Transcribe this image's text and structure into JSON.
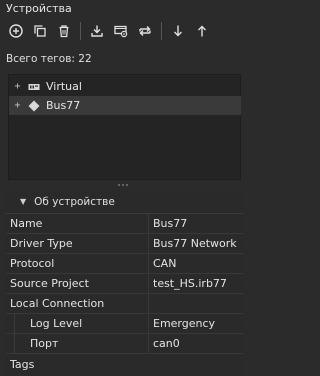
{
  "panel": {
    "title": "Устройства"
  },
  "toolbar": {
    "buttons": [
      {
        "icon": "add-circle-icon"
      },
      {
        "icon": "copy-icon"
      },
      {
        "icon": "trash-icon"
      },
      {
        "icon": "import-icon"
      },
      {
        "icon": "device-settings-icon"
      },
      {
        "icon": "swap-icon"
      },
      {
        "icon": "arrow-down-icon"
      },
      {
        "icon": "arrow-up-icon"
      }
    ]
  },
  "tag_count": "Всего тегов: 22",
  "tree": {
    "items": [
      {
        "label": "Virtual",
        "expander": "+",
        "icon": "virtual-device-icon",
        "selected": false
      },
      {
        "label": "Bus77",
        "expander": "+",
        "icon": "diamond-icon",
        "selected": true
      }
    ]
  },
  "properties": {
    "section_title": "Об устройстве",
    "rows": [
      {
        "key": "Name",
        "value": "Bus77"
      },
      {
        "key": "Driver Type",
        "value": "Bus77 Network"
      },
      {
        "key": "Protocol",
        "value": "CAN"
      },
      {
        "key": "Source Project",
        "value": "test_HS.irb77"
      },
      {
        "key": "Local Connection",
        "value": ""
      },
      {
        "key": "Log Level",
        "value": "Emergency"
      },
      {
        "key": "Порт",
        "value": "can0"
      },
      {
        "key": "Tags",
        "value": ""
      }
    ]
  }
}
